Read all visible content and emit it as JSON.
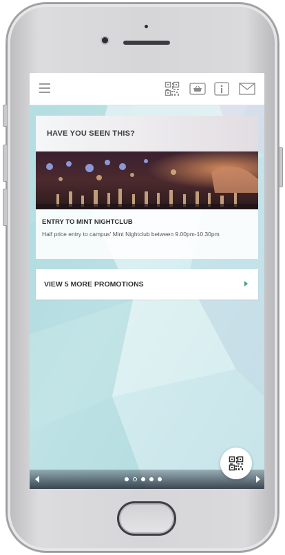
{
  "app": {
    "topbar": {
      "icons": [
        "menu-icon",
        "qr-code-icon",
        "basket-icon",
        "info-icon",
        "mail-icon"
      ]
    },
    "promo": {
      "header": "HAVE YOU SEEN THIS?",
      "title": "ENTRY TO MINT NIGHTCLUB",
      "description": "Half price entry to campus' Mint Nightclub between 9.00pm-10.30pm"
    },
    "more_promotions": {
      "label": "VIEW 5 MORE PROMOTIONS"
    },
    "pager": {
      "count": 5,
      "active_index": 1
    }
  },
  "colors": {
    "accent": "#3aa57a",
    "topbar_bg": "#ffffff",
    "screen_bg": "#cfe6ea"
  }
}
